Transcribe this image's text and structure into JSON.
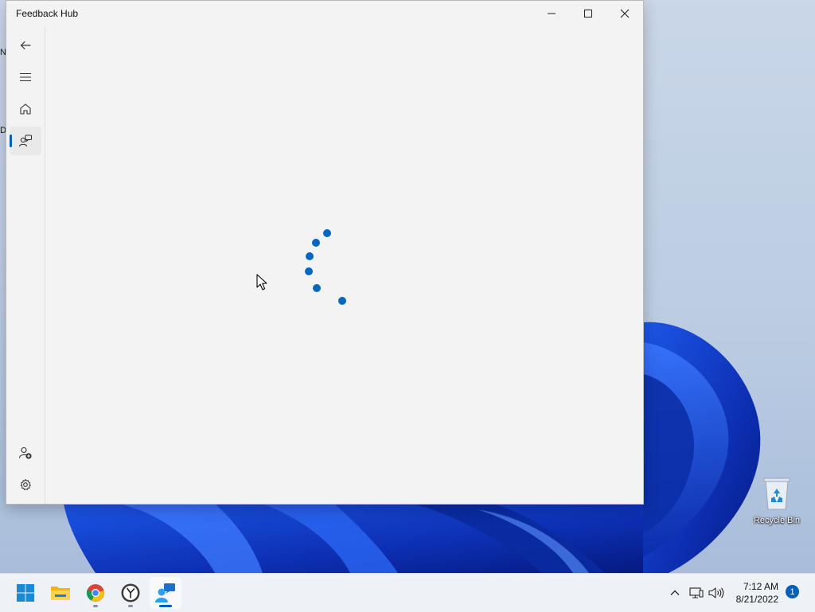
{
  "window": {
    "title": "Feedback Hub",
    "controls": [
      "minimize",
      "maximize",
      "close"
    ]
  },
  "nav": {
    "top_items": [
      {
        "icon": "back-arrow-icon"
      },
      {
        "icon": "hamburger-menu-icon"
      },
      {
        "icon": "home-icon"
      },
      {
        "icon": "feedback-icon",
        "selected": true
      }
    ],
    "bottom_items": [
      {
        "icon": "add-account-icon"
      },
      {
        "icon": "gear-icon"
      }
    ]
  },
  "content": {
    "loading": true
  },
  "desktop": {
    "edge_text_1": "N",
    "edge_text_2": "D",
    "recycle_bin_label": "Recycle Bin"
  },
  "taskbar": {
    "apps": [
      {
        "icon": "windows-start-icon"
      },
      {
        "icon": "file-explorer-icon"
      },
      {
        "icon": "chrome-icon",
        "running": true
      },
      {
        "icon": "clock-app-icon",
        "running": true
      },
      {
        "icon": "feedback-hub-icon",
        "active": true
      }
    ],
    "tray": [
      "chevron-up-icon",
      "network-icon",
      "volume-icon"
    ],
    "clock_time": "7:12 AM",
    "clock_date": "8/21/2022",
    "notification_count": "1"
  },
  "colors": {
    "accent": "#005fb8",
    "spinner": "#0067c0",
    "window_bg": "#f3f3f3",
    "taskbar_bg": "#eef1f6"
  }
}
